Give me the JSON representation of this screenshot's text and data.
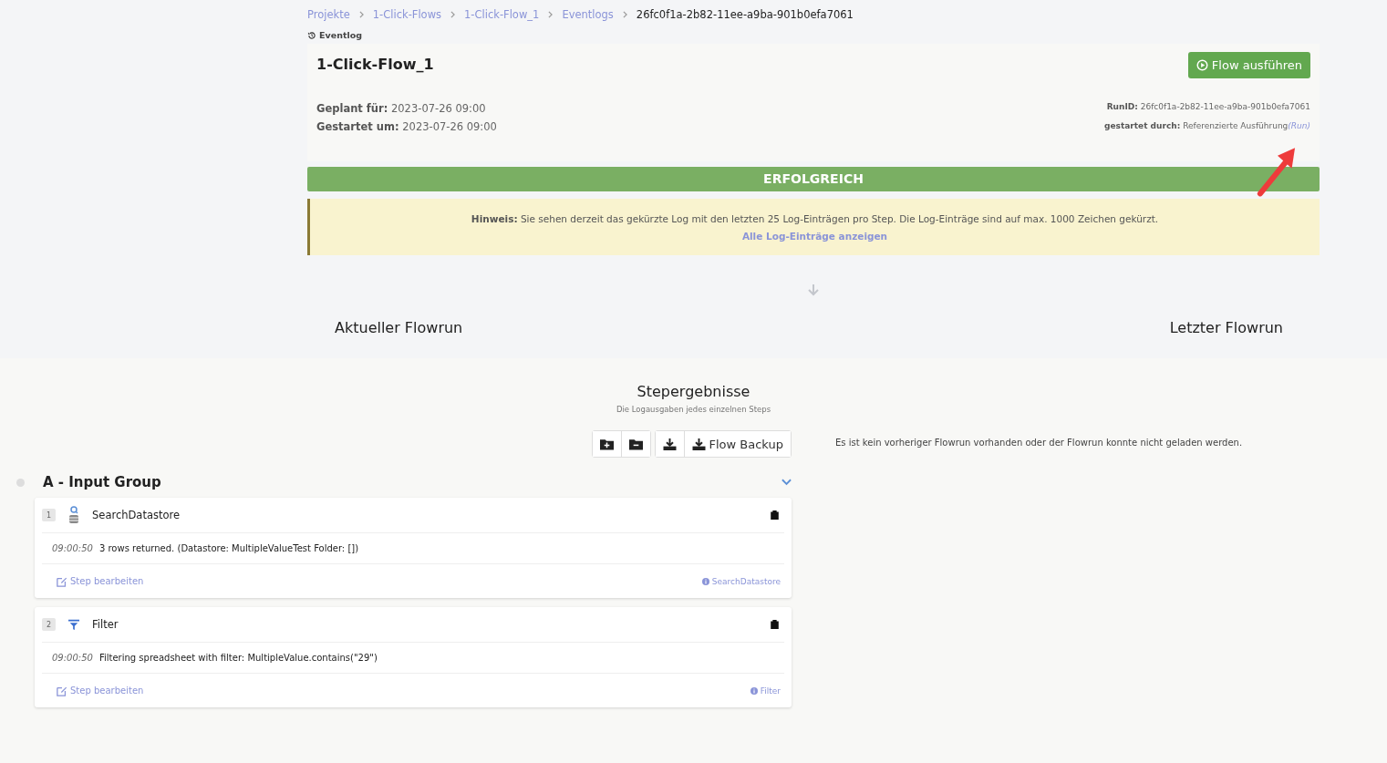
{
  "breadcrumbs": [
    "Projekte",
    "1-Click-Flows",
    "1-Click-Flow_1",
    "Eventlogs",
    "26fc0f1a-2b82-11ee-a9ba-901b0efa7061"
  ],
  "section_label": "Eventlog",
  "run": {
    "title": "1-Click-Flow_1",
    "run_button": "Flow ausführen",
    "details_left": [
      {
        "label": "Geplant für:",
        "value": "2023-07-26 09:00"
      },
      {
        "label": "Gestartet um:",
        "value": "2023-07-26 09:00"
      }
    ],
    "details_right": [
      {
        "label": "RunID:",
        "value": "26fc0f1a-2b82-11ee-a9ba-901b0efa7061"
      },
      {
        "label": "gestartet durch:",
        "value": "Referenzierte Ausführung",
        "note": "(Run)"
      }
    ]
  },
  "status": {
    "kind": "success",
    "label": "ERFOLGREICH"
  },
  "notice": {
    "text": "**Hinweis:** Sie sehen derzeit das gekürzte Log mit den letzten 25 Log-Einträgen pro Step. Die Log-Einträge sind auf max. 1000 Zeichen gekürzt.",
    "link": "Alle Log-Einträge anzeigen"
  },
  "columns": {
    "left": "Aktueller Flowrun",
    "right": "Letzter Flowrun"
  },
  "results": {
    "title": "Stepergebnisse",
    "subtitle": "Die Logausgaben jedes einzelnen Steps",
    "backup_button": "Flow Backup",
    "empty_message": "Es ist kein vorheriger Flowrun vorhanden oder der Flowrun konnte nicht geladen werden."
  },
  "group": {
    "name": "A - Input Group",
    "expanded": true,
    "steps": [
      {
        "number": "1",
        "kind": "search",
        "name": "SearchDatastore",
        "log": [
          {
            "time": "09:00:50",
            "message": "3 rows returned. (Datastore: MultipleValueTest Folder: [])"
          }
        ],
        "edit_link": "Step bearbeiten",
        "info_link": "SearchDatastore"
      },
      {
        "number": "2",
        "kind": "filter",
        "name": "Filter",
        "log": [
          {
            "time": "09:00:50",
            "message": "Filtering spreadsheet with filter: MultipleValue.contains(\"29\")"
          }
        ],
        "edit_link": "Step bearbeiten",
        "info_link": "Filter"
      }
    ]
  }
}
